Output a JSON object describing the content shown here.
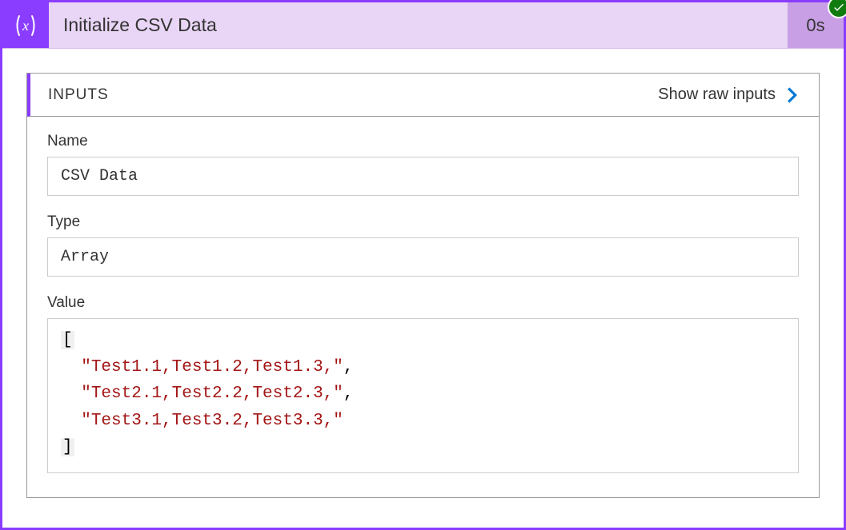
{
  "header": {
    "title": "Initialize CSV Data",
    "duration": "0s"
  },
  "panel": {
    "title": "INPUTS",
    "showRawLabel": "Show raw inputs"
  },
  "fields": {
    "name": {
      "label": "Name",
      "value": "CSV Data"
    },
    "type": {
      "label": "Type",
      "value": "Array"
    },
    "value": {
      "label": "Value",
      "items": [
        "Test1.1,Test1.2,Test1.3,",
        "Test2.1,Test2.2,Test2.3,",
        "Test3.1,Test3.2,Test3.3,"
      ]
    }
  }
}
